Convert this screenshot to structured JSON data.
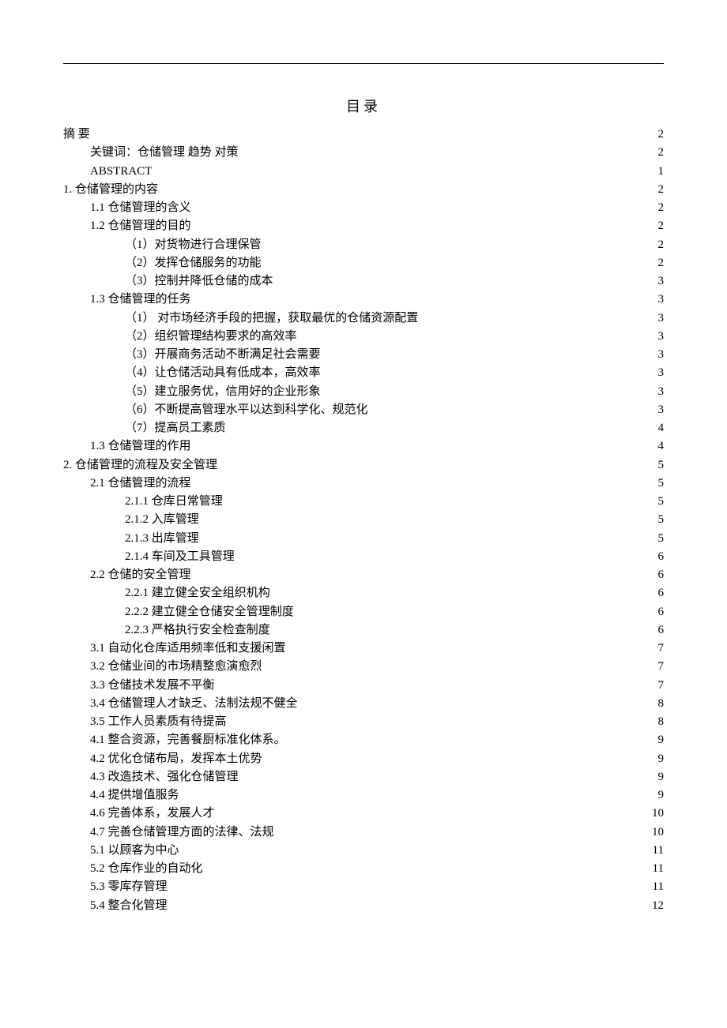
{
  "title": "目录",
  "entries": [
    {
      "label": "摘 要",
      "page": "2",
      "indent": 0
    },
    {
      "label": "关键词：仓储管理 趋势 对策",
      "page": "2",
      "indent": 1
    },
    {
      "label": "ABSTRACT",
      "page": "1",
      "indent": 1
    },
    {
      "label": "1. 仓储管理的内容",
      "page": "2",
      "indent": 0
    },
    {
      "label": "1.1 仓储管理的含义",
      "page": "2",
      "indent": 1
    },
    {
      "label": "1.2 仓储管理的目的",
      "page": "2",
      "indent": 1
    },
    {
      "label": "（1）对货物进行合理保管",
      "page": "2",
      "indent": 2
    },
    {
      "label": "（2）发挥仓储服务的功能",
      "page": "2",
      "indent": 2
    },
    {
      "label": "（3）控制并降低仓储的成本",
      "page": "3",
      "indent": 2
    },
    {
      "label": "1.3 仓储管理的任务",
      "page": "3",
      "indent": 1
    },
    {
      "label": "（1） 对市场经济手段的把握，获取最优的仓储资源配置",
      "page": "3",
      "indent": 2
    },
    {
      "label": "（2）组织管理结构要求的高效率",
      "page": "3",
      "indent": 2
    },
    {
      "label": "（3）开展商务活动不断满足社会需要",
      "page": "3",
      "indent": 2
    },
    {
      "label": "（4）让仓储活动具有低成本，高效率",
      "page": "3",
      "indent": 2
    },
    {
      "label": "（5）建立服务优，信用好的企业形象",
      "page": "3",
      "indent": 2
    },
    {
      "label": "（6）不断提高管理水平以达到科学化、规范化",
      "page": "3",
      "indent": 2
    },
    {
      "label": "（7）提高员工素质",
      "page": "4",
      "indent": 2
    },
    {
      "label": "1.3 仓储管理的作用",
      "page": "4",
      "indent": 1
    },
    {
      "label": "2. 仓储管理的流程及安全管理",
      "page": "5",
      "indent": 0
    },
    {
      "label": "2.1 仓储管理的流程",
      "page": "5",
      "indent": 1
    },
    {
      "label": "2.1.1 仓库日常管理",
      "page": "5",
      "indent": 2
    },
    {
      "label": "2.1.2 入库管理",
      "page": "5",
      "indent": 2
    },
    {
      "label": "2.1.3 出库管理",
      "page": "5",
      "indent": 2
    },
    {
      "label": "2.1.4 车间及工具管理",
      "page": "6",
      "indent": 2
    },
    {
      "label": "2.2 仓储的安全管理",
      "page": "6",
      "indent": 1
    },
    {
      "label": "2.2.1 建立健全安全组织机构",
      "page": "6",
      "indent": 2
    },
    {
      "label": "2.2.2 建立健全仓储安全管理制度",
      "page": "6",
      "indent": 2
    },
    {
      "label": "2.2.3 严格执行安全检查制度",
      "page": "6",
      "indent": 2
    },
    {
      "label": "3.1 自动化仓库适用频率低和支援闲置",
      "page": "7",
      "indent": 1
    },
    {
      "label": "3.2 仓储业间的市场精整愈演愈烈",
      "page": "7",
      "indent": 1
    },
    {
      "label": "3.3 仓储技术发展不平衡",
      "page": "7",
      "indent": 1
    },
    {
      "label": "3.4 仓储管理人才缺乏、法制法规不健全",
      "page": "8",
      "indent": 1
    },
    {
      "label": "3.5 工作人员素质有待提高",
      "page": "8",
      "indent": 1
    },
    {
      "label": "4.1  整合资源，完善餐厨标准化体系。",
      "page": "9",
      "indent": 1
    },
    {
      "label": "4.2 优化仓储布局，发挥本土优势",
      "page": "9",
      "indent": 1
    },
    {
      "label": "4.3 改造技术、强化仓储管理   ",
      "page": "9",
      "indent": 1
    },
    {
      "label": "4.4 提供增值服务",
      "page": "9",
      "indent": 1
    },
    {
      "label": "4.6 完善体系，发展人才",
      "page": "10",
      "indent": 1
    },
    {
      "label": "4.7 完善仓储管理方面的法律、法规",
      "page": "10",
      "indent": 1
    },
    {
      "label": "5.1 以顾客为中心",
      "page": "11",
      "indent": 1
    },
    {
      "label": "5.2 仓库作业的自动化",
      "page": "11",
      "indent": 1
    },
    {
      "label": "5.3  零库存管理",
      "page": "11",
      "indent": 1
    },
    {
      "label": "5.4 整合化管理",
      "page": "12",
      "indent": 1
    }
  ]
}
